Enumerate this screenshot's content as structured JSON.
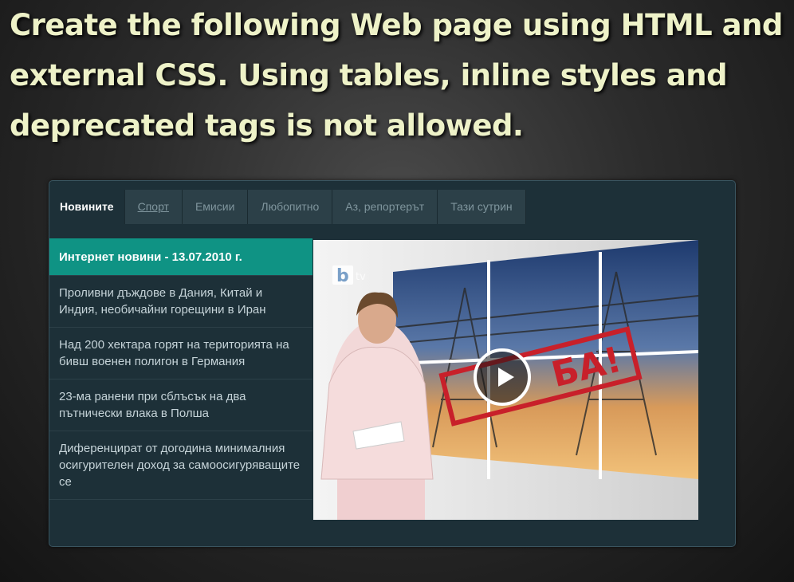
{
  "slide": {
    "title": "Create the following Web page using HTML and external CSS. Using tables, inline styles and deprecated tags is not allowed."
  },
  "tabs": [
    {
      "label": "Новините",
      "state": "active"
    },
    {
      "label": "Спорт",
      "state": "hover"
    },
    {
      "label": "Емисии",
      "state": "normal"
    },
    {
      "label": "Любопитно",
      "state": "normal"
    },
    {
      "label": "Аз, репортерът",
      "state": "normal"
    },
    {
      "label": "Тази сутрин",
      "state": "normal"
    }
  ],
  "news": [
    {
      "text": "Интернет новини - 13.07.2010 г.",
      "selected": true
    },
    {
      "text": "Проливни дъждове в Дания, Китай и Индия, необичайни горещини в Иран",
      "selected": false
    },
    {
      "text": "Над 200 хектара горят на територията на бивш военен полигон в Германия",
      "selected": false
    },
    {
      "text": "23-ма ранени при сблъсък на два пътнически влака в Полша",
      "selected": false
    },
    {
      "text": "Диференцират от догодина минималния осигурителен доход за самоосигуряващите се",
      "selected": false
    }
  ],
  "video": {
    "logo_text": "btv",
    "stamp_text": "БА!",
    "play_icon": "play-icon"
  },
  "colors": {
    "title": "#eef2c8",
    "widget_bg": "#1d3038",
    "tab_bg": "#2c4048",
    "selected_bg": "#0f9384"
  }
}
